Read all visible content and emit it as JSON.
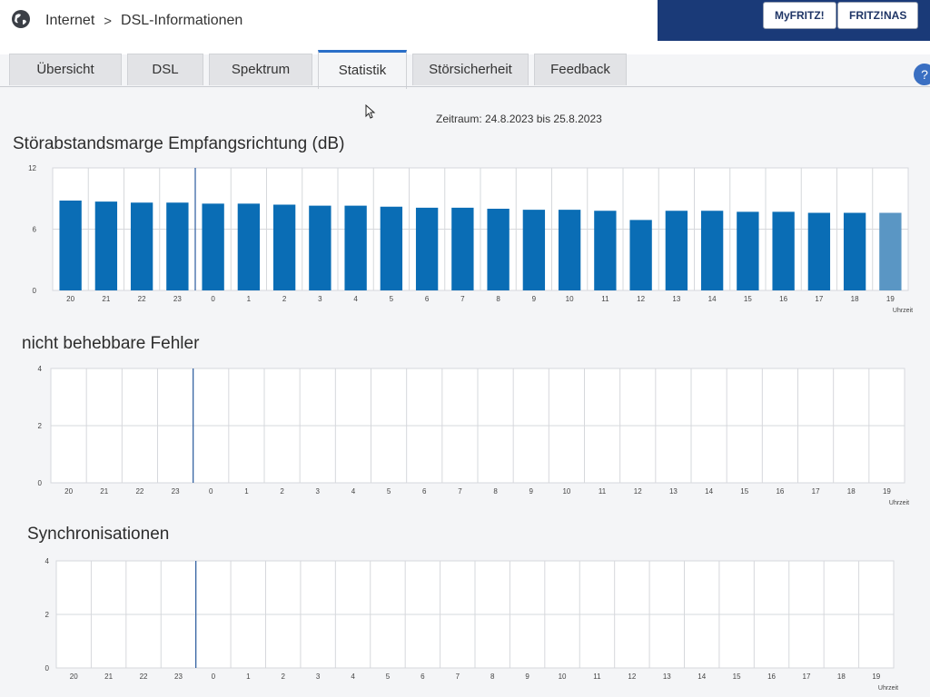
{
  "breadcrumb": {
    "root": "Internet",
    "separator": ">",
    "page": "DSL-Informationen"
  },
  "top_buttons": {
    "myfritz": "MyFRITZ!",
    "fritznas": "FRITZ!NAS"
  },
  "help_label": "?",
  "tabs": [
    {
      "label": "Übersicht",
      "active": false
    },
    {
      "label": "DSL",
      "active": false
    },
    {
      "label": "Spektrum",
      "active": false
    },
    {
      "label": "Statistik",
      "active": true
    },
    {
      "label": "Störsicherheit",
      "active": false
    },
    {
      "label": "Feedback",
      "active": false
    }
  ],
  "zeitraum": "Zeitraum: 24.8.2023 bis 25.8.2023",
  "colors": {
    "accent": "#2a6fc8",
    "bar": "#0a6db5",
    "bar_current": "#5a96c4",
    "grid": "#d6d8dc",
    "header_band": "#1a3a78"
  },
  "chart_data": [
    {
      "type": "bar",
      "title": "Störabstandsmarge Empfangsrichtung (dB)",
      "categories": [
        "20",
        "21",
        "22",
        "23",
        "0",
        "1",
        "2",
        "3",
        "4",
        "5",
        "6",
        "7",
        "8",
        "9",
        "10",
        "11",
        "12",
        "13",
        "14",
        "15",
        "16",
        "17",
        "18",
        "19"
      ],
      "values": [
        8.8,
        8.7,
        8.6,
        8.6,
        8.5,
        8.5,
        8.4,
        8.3,
        8.3,
        8.2,
        8.1,
        8.1,
        8.0,
        7.9,
        7.9,
        7.8,
        6.9,
        7.8,
        7.8,
        7.7,
        7.7,
        7.6,
        7.6,
        7.6
      ],
      "yticks": [
        "0",
        "6",
        "12"
      ],
      "ylim": [
        0,
        12
      ],
      "xlabel": "Uhrzeit"
    },
    {
      "type": "bar",
      "title": "nicht behebbare Fehler",
      "categories": [
        "20",
        "21",
        "22",
        "23",
        "0",
        "1",
        "2",
        "3",
        "4",
        "5",
        "6",
        "7",
        "8",
        "9",
        "10",
        "11",
        "12",
        "13",
        "14",
        "15",
        "16",
        "17",
        "18",
        "19"
      ],
      "values": [
        0,
        0,
        0,
        0,
        0,
        0,
        0,
        0,
        0,
        0,
        0,
        0,
        0,
        0,
        0,
        0,
        0,
        0,
        0,
        0,
        0,
        0,
        0,
        0
      ],
      "yticks": [
        "0",
        "2",
        "4"
      ],
      "ylim": [
        0,
        4
      ],
      "xlabel": "Uhrzeit"
    },
    {
      "type": "bar",
      "title": "Synchronisationen",
      "categories": [
        "20",
        "21",
        "22",
        "23",
        "0",
        "1",
        "2",
        "3",
        "4",
        "5",
        "6",
        "7",
        "8",
        "9",
        "10",
        "11",
        "12",
        "13",
        "14",
        "15",
        "16",
        "17",
        "18",
        "19"
      ],
      "values": [
        0,
        0,
        0,
        0,
        0,
        0,
        0,
        0,
        0,
        0,
        0,
        0,
        0,
        0,
        0,
        0,
        0,
        0,
        0,
        0,
        0,
        0,
        0,
        0
      ],
      "yticks": [
        "0",
        "2",
        "4"
      ],
      "ylim": [
        0,
        4
      ],
      "xlabel": "Uhrzeit"
    }
  ]
}
